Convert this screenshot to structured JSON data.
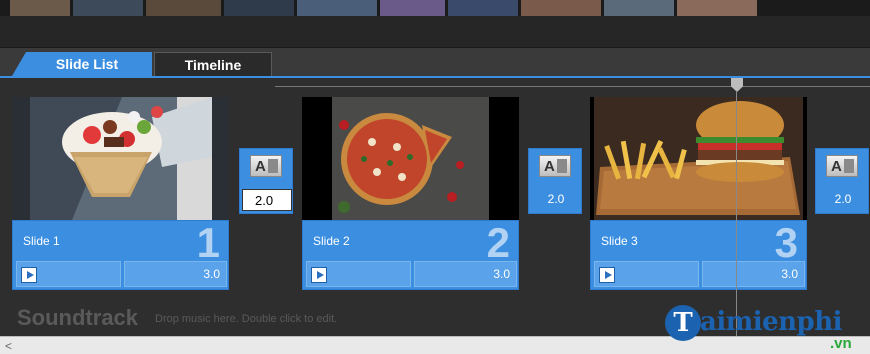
{
  "tabs": [
    {
      "label": "Slide List",
      "active": true
    },
    {
      "label": "Timeline",
      "active": false
    }
  ],
  "slides": [
    {
      "name": "Slide 1",
      "number": "1",
      "duration": "3.0",
      "image": "dessert-cone"
    },
    {
      "name": "Slide 2",
      "number": "2",
      "duration": "3.0",
      "image": "pizza"
    },
    {
      "name": "Slide 3",
      "number": "3",
      "duration": "3.0",
      "image": "burger-fries"
    }
  ],
  "transitions": [
    {
      "icon": "ab-transition-icon",
      "duration": "2.0",
      "editing": true
    },
    {
      "icon": "ab-transition-icon",
      "duration": "2.0",
      "editing": false
    },
    {
      "icon": "ab-transition-icon",
      "duration": "2.0",
      "editing": false
    }
  ],
  "soundtrack": {
    "title": "Soundtrack",
    "hint": "Drop music here.  Double click to edit."
  },
  "scrollbar": {
    "left_arrow": "<"
  },
  "watermark": {
    "main": "aimienphi",
    "logo_letter": "T",
    "suffix": ".vn"
  },
  "colors": {
    "accent": "#3c8fe0",
    "panel": "#2e2e2e"
  }
}
